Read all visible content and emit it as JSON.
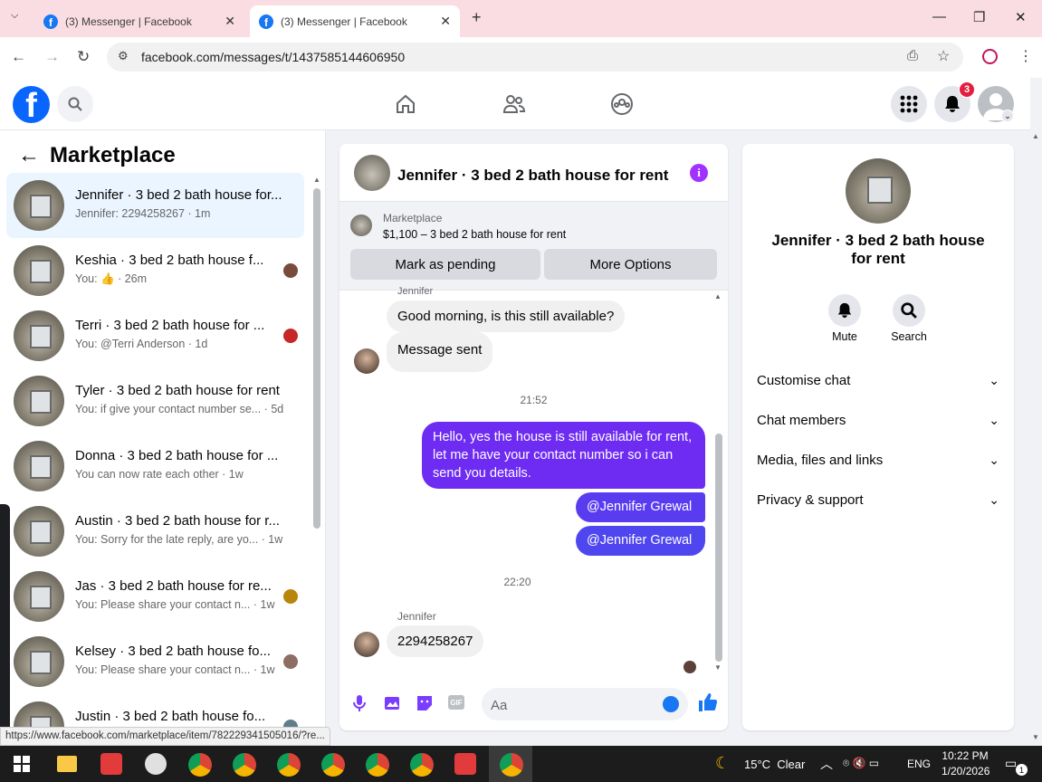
{
  "browser": {
    "tabs": [
      {
        "title": "(3) Messenger | Facebook",
        "active": false
      },
      {
        "title": "(3) Messenger | Facebook",
        "active": true
      }
    ],
    "url": "facebook.com/messages/t/1437585144606950",
    "status_url": "https://www.facebook.com/marketplace/item/782229341505016/?re..."
  },
  "header": {
    "notification_count": "3"
  },
  "sidebar": {
    "title": "Marketplace",
    "conversations": [
      {
        "name": "Jennifer · 3 bed 2 bath house for...",
        "preview": "Jennifer: 2294258267 · 1m",
        "active": true
      },
      {
        "name": "Keshia · 3 bed 2 bath house f...",
        "preview": "You: 👍 · 26m",
        "active": false
      },
      {
        "name": "Terri · 3 bed 2 bath house for ...",
        "preview": "You: @Terri Anderson · 1d",
        "active": false
      },
      {
        "name": "Tyler · 3 bed 2 bath house for rent",
        "preview": "You: if give your contact number se... · 5d",
        "active": false
      },
      {
        "name": "Donna · 3 bed 2 bath house for ...",
        "preview": "You can now rate each other · 1w",
        "active": false
      },
      {
        "name": "Austin · 3 bed 2 bath house for r...",
        "preview": "You: Sorry for the late reply, are yo... · 1w",
        "active": false
      },
      {
        "name": "Jas · 3 bed 2 bath house for re...",
        "preview": "You: Please share your contact n... · 1w",
        "active": false
      },
      {
        "name": "Kelsey · 3 bed 2 bath house fo...",
        "preview": "You: Please share your contact n... · 1w",
        "active": false
      },
      {
        "name": "Justin · 3 bed 2 bath house fo...",
        "preview": "",
        "active": false
      }
    ]
  },
  "chat": {
    "title": "Jennifer · 3 bed 2 bath house for rent",
    "marketplace_label": "Marketplace",
    "listing": "$1,100 – 3 bed 2 bath house for rent",
    "mark_pending": "Mark as pending",
    "more_options": "More Options",
    "sender_name_top": "Jennifer",
    "msg1": "Good morning, is this still available?",
    "msg2": "Message sent",
    "time1": "21:52",
    "reply": "Hello, yes the house is still available for rent, let me have your contact number so i can send you details.",
    "mention1": "@Jennifer Grewal",
    "mention2": "@Jennifer Grewal",
    "time2": "22:20",
    "sender_name": "Jennifer",
    "msg3": "2294258267",
    "input_placeholder": "Aa"
  },
  "details": {
    "name": "Jennifer · 3 bed 2 bath house for rent",
    "mute": "Mute",
    "search": "Search",
    "sections": [
      "Customise chat",
      "Chat members",
      "Media, files and links",
      "Privacy & support"
    ]
  },
  "taskbar": {
    "weather": "15°C  Clear",
    "lang": "ENG",
    "time": "10:22 PM",
    "date": "1/20/2026",
    "notif": "1"
  },
  "colors": {
    "brand": "#0866ff",
    "outgoing_bubble": "#6e2cf3",
    "accent_purple": "#a033ff"
  }
}
